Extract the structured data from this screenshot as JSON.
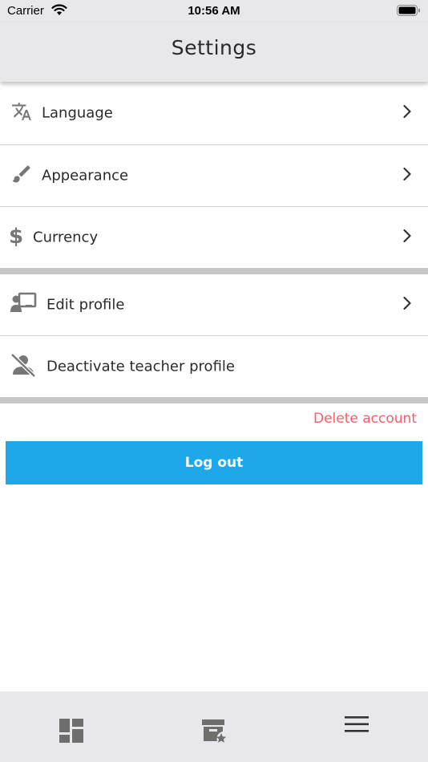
{
  "status_bar": {
    "carrier": "Carrier",
    "time": "10:56 AM"
  },
  "header": {
    "title": "Settings"
  },
  "settings_group_1": [
    {
      "label": "Language",
      "icon": "translate-icon"
    },
    {
      "label": "Appearance",
      "icon": "paintbrush-icon"
    },
    {
      "label": "Currency",
      "icon": "dollar-icon"
    }
  ],
  "settings_group_2": [
    {
      "label": "Edit profile",
      "icon": "teacher-board-icon"
    },
    {
      "label": "Deactivate teacher profile",
      "icon": "person-off-icon"
    }
  ],
  "delete_account_label": "Delete account",
  "logout_label": "Log out",
  "tab_bar": [
    {
      "icon": "dashboard-icon"
    },
    {
      "icon": "archive-star-icon"
    },
    {
      "icon": "menu-icon"
    }
  ],
  "colors": {
    "accent": "#1ea7ea",
    "danger": "#ff5a6a",
    "bar_background": "#e8e8ec",
    "section_separator": "#c6c6c6"
  }
}
